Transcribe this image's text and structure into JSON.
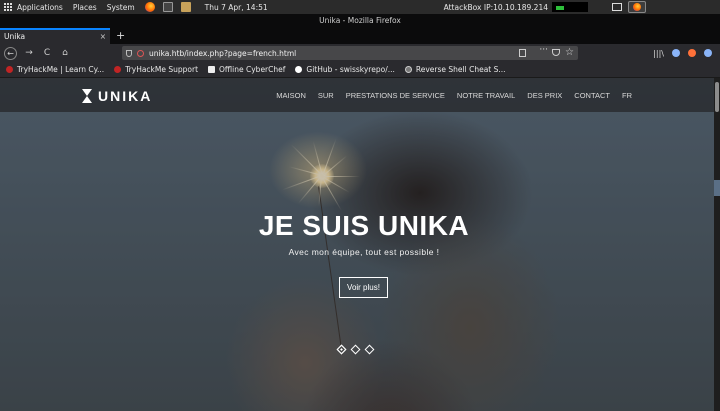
{
  "os_panel": {
    "applications": "Applications",
    "places": "Places",
    "system": "System",
    "clock": "Thu 7 Apr, 14:51",
    "attackbox_ip": "AttackBox IP:10.10.189.214"
  },
  "window": {
    "title": "Unika - Mozilla Firefox"
  },
  "tab": {
    "title": "Unika",
    "close": "×",
    "new_tab": "+"
  },
  "toolbar": {
    "back": "←",
    "forward": "→",
    "reload": "C",
    "home": "⌂",
    "url": "unika.htb/index.php?page=french.html",
    "more": "···",
    "star": "☆",
    "library": "|||\\"
  },
  "bookmarks": [
    {
      "label": "TryHackMe | Learn Cy...",
      "icon": "tryhackme-icon"
    },
    {
      "label": "TryHackMe Support",
      "icon": "tryhackme-icon"
    },
    {
      "label": "Offline CyberChef",
      "icon": "chef-icon"
    },
    {
      "label": "GitHub - swisskyrepo/...",
      "icon": "github-icon"
    },
    {
      "label": "Reverse Shell Cheat S...",
      "icon": "globe-icon"
    }
  ],
  "site": {
    "logo": "UNIKA",
    "nav": [
      "MAISON",
      "SUR",
      "PRESTATIONS DE SERVICE",
      "NOTRE TRAVAIL",
      "DES PRIX",
      "CONTACT",
      "FR"
    ]
  },
  "hero": {
    "title": "JE SUIS UNIKA",
    "subtitle": "Avec mon équipe, tout est possible !",
    "button": "Voir plus!",
    "slides": 3,
    "active_slide": 1
  }
}
